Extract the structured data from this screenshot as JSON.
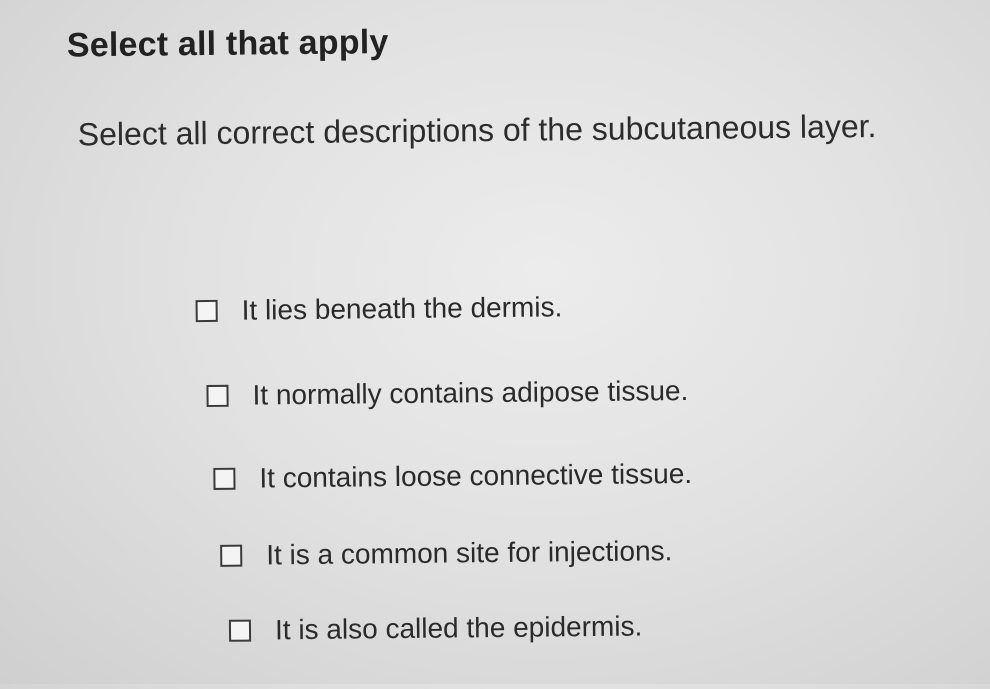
{
  "question": {
    "type_label": "Select all that apply",
    "prompt": "Select all correct descriptions of the subcutaneous layer."
  },
  "options": [
    {
      "label": "It lies beneath the dermis.",
      "checked": false
    },
    {
      "label": "It normally contains adipose tissue.",
      "checked": false
    },
    {
      "label": "It contains loose connective tissue.",
      "checked": false
    },
    {
      "label": "It is a common site for injections.",
      "checked": false
    },
    {
      "label": "It is also called the epidermis.",
      "checked": false
    }
  ]
}
